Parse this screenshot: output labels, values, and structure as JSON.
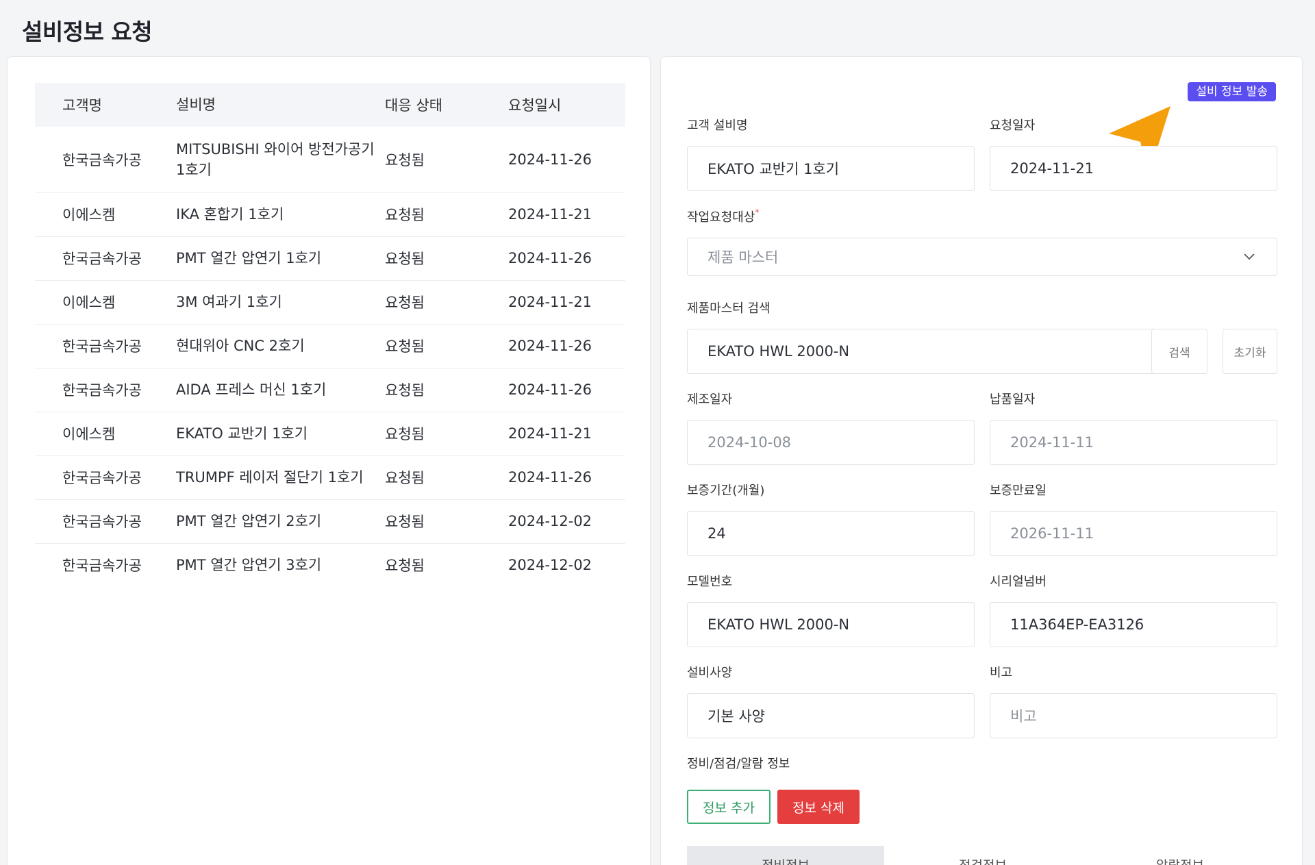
{
  "page": {
    "title": "설비정보 요청"
  },
  "table": {
    "headers": {
      "customer": "고객명",
      "equipment": "설비명",
      "status": "대응 상태",
      "date": "요청일시"
    },
    "rows": [
      {
        "customer": "한국금속가공",
        "equipment": "MITSUBISHI 와이어 방전가공기 1호기",
        "status": "요청됨",
        "date": "2024-11-26"
      },
      {
        "customer": "이에스켐",
        "equipment": "IKA 혼합기 1호기",
        "status": "요청됨",
        "date": "2024-11-21"
      },
      {
        "customer": "한국금속가공",
        "equipment": "PMT 열간 압연기 1호기",
        "status": "요청됨",
        "date": "2024-11-26"
      },
      {
        "customer": "이에스켐",
        "equipment": "3M 여과기 1호기",
        "status": "요청됨",
        "date": "2024-11-21"
      },
      {
        "customer": "한국금속가공",
        "equipment": "현대위아 CNC 2호기",
        "status": "요청됨",
        "date": "2024-11-26"
      },
      {
        "customer": "한국금속가공",
        "equipment": "AIDA 프레스 머신 1호기",
        "status": "요청됨",
        "date": "2024-11-26"
      },
      {
        "customer": "이에스켐",
        "equipment": "EKATO 교반기 1호기",
        "status": "요청됨",
        "date": "2024-11-21"
      },
      {
        "customer": "한국금속가공",
        "equipment": "TRUMPF 레이저 절단기 1호기",
        "status": "요청됨",
        "date": "2024-11-26"
      },
      {
        "customer": "한국금속가공",
        "equipment": "PMT 열간 압연기 2호기",
        "status": "요청됨",
        "date": "2024-12-02"
      },
      {
        "customer": "한국금속가공",
        "equipment": "PMT 열간 압연기 3호기",
        "status": "요청됨",
        "date": "2024-12-02"
      }
    ]
  },
  "form": {
    "send_label": "설비 정보 발송",
    "customer_equipment": {
      "label": "고객 설비명",
      "value": "EKATO 교반기 1호기"
    },
    "request_date": {
      "label": "요청일자",
      "value": "2024-11-21"
    },
    "work_target": {
      "label": "작업요청대상",
      "required_mark": "*",
      "value": "제품 마스터"
    },
    "product_search": {
      "label": "제품마스터 검색",
      "value": "EKATO HWL 2000-N",
      "search_label": "검색",
      "reset_label": "초기화"
    },
    "manufacture_date": {
      "label": "제조일자",
      "value": "2024-10-08"
    },
    "delivery_date": {
      "label": "납품일자",
      "value": "2024-11-11"
    },
    "warranty_months": {
      "label": "보증기간(개월)",
      "value": "24"
    },
    "warranty_end": {
      "label": "보증만료일",
      "value": "2026-11-11"
    },
    "model_number": {
      "label": "모델번호",
      "value": "EKATO HWL 2000-N"
    },
    "serial_number": {
      "label": "시리얼넘버",
      "value": "11A364EP-EA3126"
    },
    "spec": {
      "label": "설비사양",
      "value": "기본 사양"
    },
    "note": {
      "label": "비고",
      "placeholder": "비고"
    },
    "info_section": {
      "label": "정비/점검/알람 정보",
      "add_label": "정보 추가",
      "delete_label": "정보 삭제"
    },
    "tabs": [
      "정비정보",
      "점검정보",
      "알람정보"
    ]
  },
  "colors": {
    "accent": "#5b4ef0",
    "arrow": "#f59e0b",
    "add": "#3db075",
    "delete": "#e53e3e"
  },
  "icons": {
    "dropdown": "chevron-down-icon",
    "pointer": "cursor-arrow-icon"
  }
}
